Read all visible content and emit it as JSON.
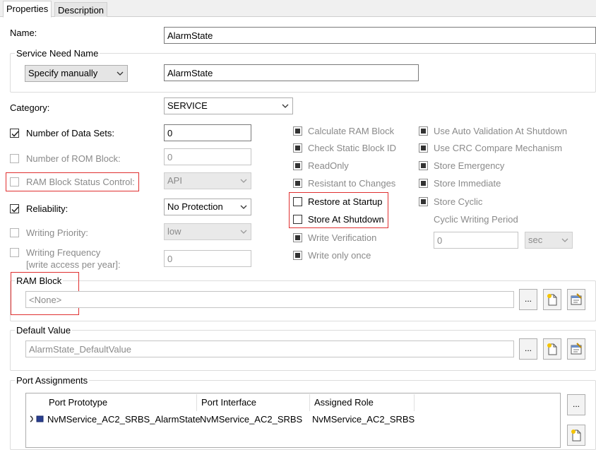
{
  "tabs": [
    {
      "label": "Properties",
      "active": true
    },
    {
      "label": "Description",
      "active": false
    }
  ],
  "name": {
    "label": "Name:",
    "value": "AlarmState"
  },
  "service_need": {
    "group_title": "Service Need Name",
    "mode": "Specify manually",
    "value": "AlarmState"
  },
  "category": {
    "label": "Category:",
    "value": "SERVICE"
  },
  "left_options": {
    "num_data_sets": {
      "label": "Number of Data Sets:",
      "checked": true,
      "value": "0"
    },
    "num_rom_block": {
      "label": "Number of ROM Block:",
      "checked": false,
      "value": "0"
    },
    "ram_status_ctrl": {
      "label": "RAM Block Status Control:",
      "checked": false,
      "value": "API"
    },
    "reliability": {
      "label": "Reliability:",
      "checked": true,
      "value": "No Protection"
    },
    "writing_priority": {
      "label": "Writing Priority:",
      "checked": false,
      "value": "low"
    },
    "writing_freq": {
      "label_line1": "Writing Frequency",
      "label_line2": "[write access per year]:",
      "checked": false,
      "value": "0"
    }
  },
  "middle_options": {
    "calc_ram": "Calculate RAM Block",
    "check_static": "Check Static Block ID",
    "read_only": "ReadOnly",
    "resistant": "Resistant to Changes",
    "restore_startup": "Restore at Startup",
    "store_shutdown": "Store At Shutdown",
    "write_verification": "Write Verification",
    "write_once": "Write only once"
  },
  "right_options": {
    "auto_validation": "Use Auto Validation At Shutdown",
    "crc_compare": "Use CRC Compare Mechanism",
    "store_emergency": "Store Emergency",
    "store_immediate": "Store Immediate",
    "store_cyclic": "Store Cyclic",
    "cyclic_period_label": "Cyclic Writing Period",
    "cyclic_period_value": "0",
    "cyclic_unit": "sec"
  },
  "ram_block": {
    "group_title": "RAM Block",
    "value": "<None>",
    "browse": "..."
  },
  "default_value": {
    "group_title": "Default Value",
    "value": "AlarmState_DefaultValue",
    "browse": "..."
  },
  "port_assignments": {
    "group_title": "Port Assignments",
    "columns": [
      "Port Prototype",
      "Port Interface",
      "Assigned Role"
    ],
    "rows": [
      [
        "NvMService_AC2_SRBS_AlarmState",
        "NvMService_AC2_SRBS",
        "NvMService_AC2_SRBS"
      ]
    ],
    "browse": "..."
  },
  "colors": {
    "highlight": "#e03030",
    "disabled_text": "#8a8a8a"
  }
}
